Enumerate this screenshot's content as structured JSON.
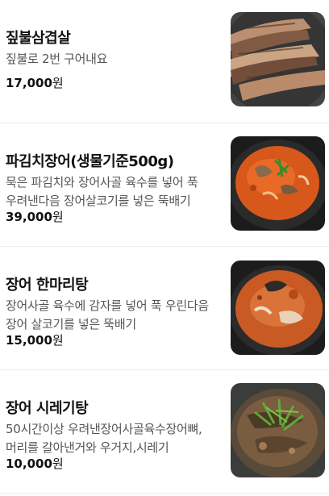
{
  "menu": {
    "items": [
      {
        "name": "짚불삼겹살",
        "description": "짚불로 2번 구어내요",
        "price": "17,000",
        "currency": "원",
        "image_icon": "grilled-pork-belly-image"
      },
      {
        "name": "파김치장어(생물기준500g)",
        "description": "묵은 파김치와 장어사골 육수를 넣어 푹 우려낸다음 장어살코기를 넣은 뚝배기",
        "price": "39,000",
        "currency": "원",
        "image_icon": "eel-stew-image"
      },
      {
        "name": "장어 한마리탕",
        "description": "장어사골 육수에 감자를 넣어 푹 우린다음 장어 살코기를 넣은 뚝배기",
        "price": "15,000",
        "currency": "원",
        "image_icon": "eel-soup-image"
      },
      {
        "name": "장어 시레기탕",
        "description": "50시간이상 우려낸장어사골육수장어뼈,머리를 갈아낸거와 우거지,시레기",
        "price": "10,000",
        "currency": "원",
        "image_icon": "siraegi-soup-image"
      }
    ]
  }
}
